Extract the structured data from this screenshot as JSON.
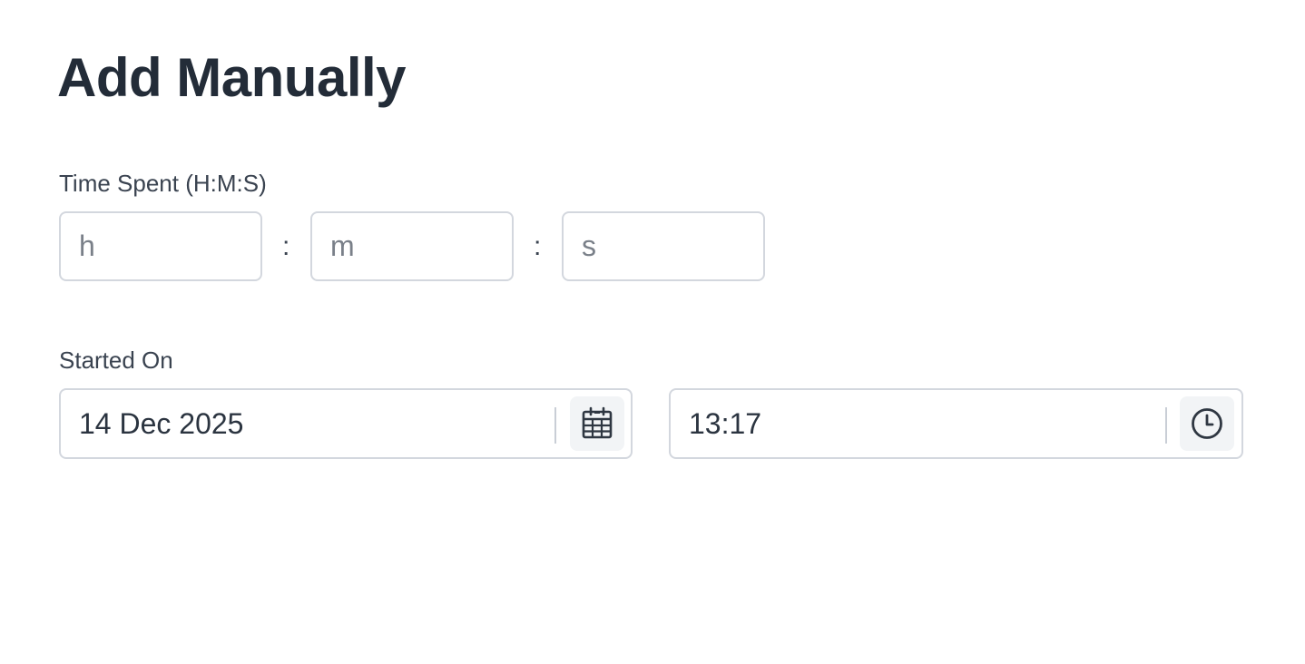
{
  "page": {
    "title": "Add Manually"
  },
  "time_spent": {
    "label": "Time Spent (H:M:S)",
    "hours": {
      "value": "",
      "placeholder": "h"
    },
    "minutes": {
      "value": "",
      "placeholder": "m"
    },
    "seconds": {
      "value": "",
      "placeholder": "s"
    },
    "separator": ":"
  },
  "started_on": {
    "label": "Started On",
    "date": {
      "value": "14 Dec 2025",
      "icon": "calendar-icon"
    },
    "time": {
      "value": "13:17",
      "icon": "clock-icon"
    }
  },
  "colors": {
    "text": "#232c38",
    "border": "#d3d7de",
    "icon_bg": "#f2f4f6",
    "placeholder": "#7a8089"
  }
}
